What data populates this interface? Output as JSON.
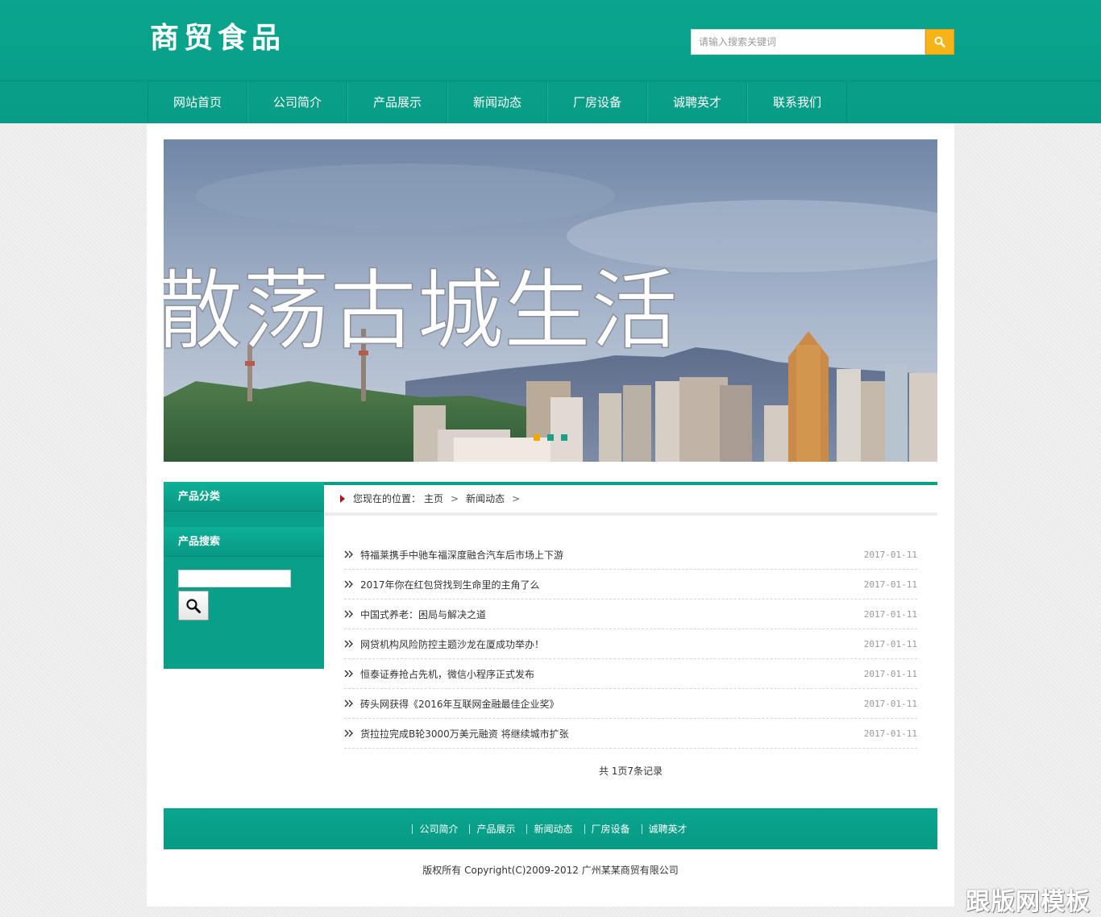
{
  "header": {
    "logo_text": "商贸食品",
    "search_placeholder": "请输入搜索关键词"
  },
  "nav": [
    "网站首页",
    "公司简介",
    "产品展示",
    "新闻动态",
    "厂房设备",
    "诚聘英才",
    "联系我们"
  ],
  "banner": {
    "headline": "散荡古城生活",
    "slide_count": 3,
    "active_slide": 1,
    "colors": {
      "active_dot": "#f7a800",
      "dot": "#1a9f8a"
    }
  },
  "sidebar": {
    "category_title": "产品分类",
    "search_title": "产品搜索"
  },
  "breadcrumb": {
    "prefix": "您现在的位置：",
    "items": [
      "主页",
      "新闻动态"
    ],
    "separator": ">"
  },
  "news": [
    {
      "title": "特福莱携手中驰车福深度融合汽车后市场上下游",
      "date": "2017-01-11"
    },
    {
      "title": "2017年你在红包贷找到生命里的主角了么",
      "date": "2017-01-11"
    },
    {
      "title": "中国式养老：困局与解决之道",
      "date": "2017-01-11"
    },
    {
      "title": "网贷机构风险防控主题沙龙在厦成功举办！",
      "date": "2017-01-11"
    },
    {
      "title": "恒泰证券抢占先机，微信小程序正式发布",
      "date": "2017-01-11"
    },
    {
      "title": "砖头网获得《2016年互联网金融最佳企业奖》",
      "date": "2017-01-11"
    },
    {
      "title": "货拉拉完成B轮3000万美元融资 将继续城市扩张",
      "date": "2017-01-11"
    }
  ],
  "pager_text": "共 1页7条记录",
  "footer": {
    "links": [
      "公司简介",
      "产品展示",
      "新闻动态",
      "厂房设备",
      "诚聘英才"
    ],
    "copyright": "版权所有 Copyright(C)2009-2012 广州某某商贸有限公司"
  },
  "watermark": "跟版网模板",
  "colors": {
    "brand": "#0aa58e",
    "search_button": "#f7b418",
    "breadcrumb_arrow": "#b5121b"
  }
}
